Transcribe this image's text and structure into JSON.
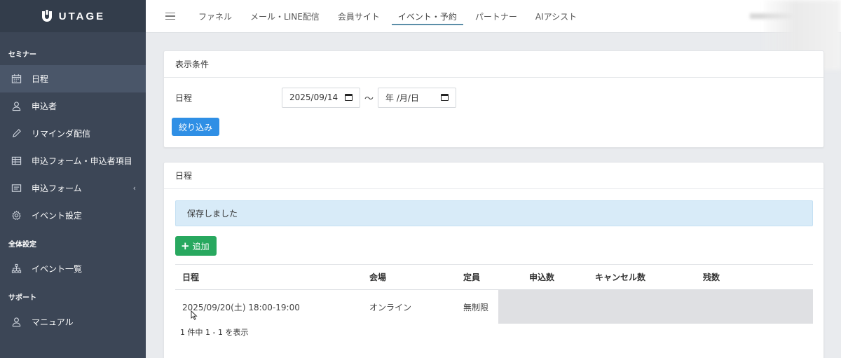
{
  "brand": {
    "name": "UTAGE"
  },
  "sidebar": {
    "sections": [
      {
        "title": "セミナー",
        "items": [
          {
            "label": "日程",
            "icon": "calendar-icon",
            "active": true
          },
          {
            "label": "申込者",
            "icon": "user-icon"
          },
          {
            "label": "リマインダ配信",
            "icon": "pencil-icon"
          },
          {
            "label": "申込フォーム・申込者項目",
            "icon": "table-icon"
          },
          {
            "label": "申込フォーム",
            "icon": "form-icon",
            "has_chevron": true,
            "chevron": "‹"
          },
          {
            "label": "イベント設定",
            "icon": "gear-icon"
          }
        ]
      },
      {
        "title": "全体設定",
        "items": [
          {
            "label": "イベント一覧",
            "icon": "sitemap-icon"
          }
        ]
      },
      {
        "title": "サポート",
        "items": [
          {
            "label": "マニュアル",
            "icon": "user-icon"
          }
        ]
      }
    ]
  },
  "topnav": {
    "items": [
      {
        "label": "ファネル"
      },
      {
        "label": "メール・LINE配信"
      },
      {
        "label": "会員サイト"
      },
      {
        "label": "イベント・予約",
        "active": true
      },
      {
        "label": "パートナー"
      },
      {
        "label": "AIアシスト"
      }
    ]
  },
  "filter": {
    "header": "表示条件",
    "date_label": "日程",
    "date_from": "2025/09/14",
    "date_to": "年 /月/日",
    "separator": "〜",
    "submit_label": "絞り込み"
  },
  "schedule": {
    "header": "日程",
    "alert": "保存しました",
    "add_label": "追加",
    "columns": [
      "日程",
      "会場",
      "定員",
      "申込数",
      "キャンセル数",
      "残数"
    ],
    "rows": [
      {
        "date": "2025/09/20(土) 18:00-19:00",
        "venue": "オンライン",
        "capacity": "無制限",
        "applications": "",
        "cancellations": "",
        "remaining": ""
      }
    ],
    "footer": "1 件中 1 - 1 を表示"
  },
  "colors": {
    "sidebar_bg": "#3c4656",
    "accent_blue": "#2f8fe5",
    "accent_green": "#28a85f",
    "alert_bg": "#d8ebf8"
  }
}
